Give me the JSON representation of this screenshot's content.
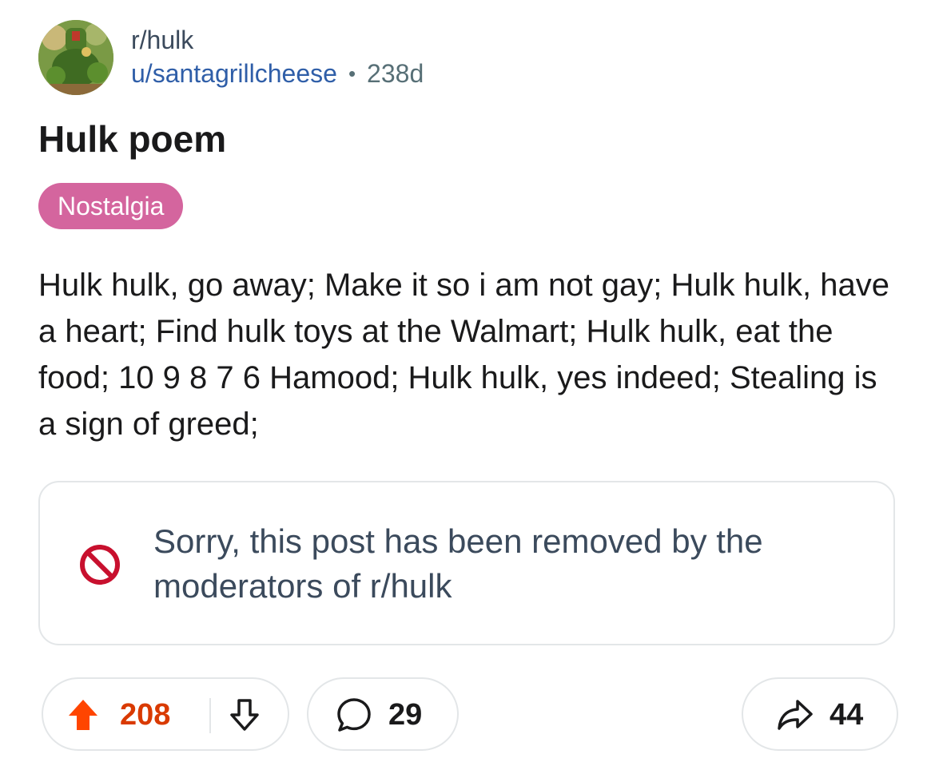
{
  "post": {
    "subreddit": "r/hulk",
    "username": "u/santagrillcheese",
    "separator": "•",
    "age": "238d",
    "title": "Hulk poem",
    "flair": "Nostalgia",
    "body": "Hulk hulk, go away; Make it so i am not gay; Hulk hulk, have a heart; Find hulk toys at the Walmart; Hulk hulk, eat the food; 10 9 8 7 6 Hamood; Hulk hulk, yes indeed; Stealing is a sign of greed;"
  },
  "removed_notice": {
    "icon": "prohibited-icon",
    "text": "Sorry, this post has been removed by the moderators of r/hulk"
  },
  "actions": {
    "upvote_count": "208",
    "comment_count": "29",
    "share_count": "44"
  },
  "colors": {
    "flair_bg": "#d4659e",
    "upvote_active": "#ff4500",
    "upvote_count": "#d93a00",
    "username": "#2f5ea8",
    "removed_icon": "#c8102e"
  },
  "icons": [
    "avatar",
    "upvote-arrow-icon",
    "downvote-arrow-icon",
    "comment-bubble-icon",
    "share-arrow-icon",
    "prohibited-icon"
  ]
}
